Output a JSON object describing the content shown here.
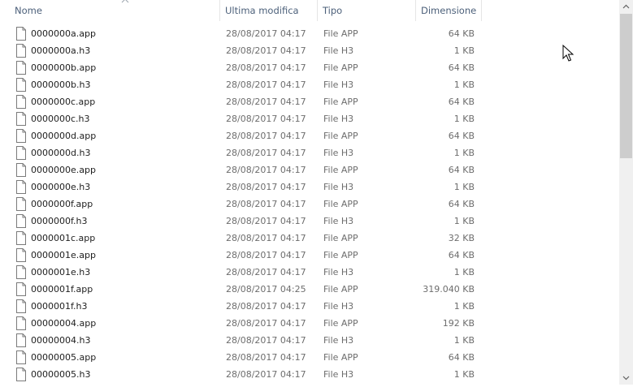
{
  "columns": {
    "name": "Nome",
    "modified": "Ultima modifica",
    "type": "Tipo",
    "size": "Dimensione"
  },
  "files": [
    {
      "name": "0000000a.app",
      "modified": "28/08/2017 04:17",
      "type": "File APP",
      "size": "64 KB"
    },
    {
      "name": "0000000a.h3",
      "modified": "28/08/2017 04:17",
      "type": "File H3",
      "size": "1 KB"
    },
    {
      "name": "0000000b.app",
      "modified": "28/08/2017 04:17",
      "type": "File APP",
      "size": "64 KB"
    },
    {
      "name": "0000000b.h3",
      "modified": "28/08/2017 04:17",
      "type": "File H3",
      "size": "1 KB"
    },
    {
      "name": "0000000c.app",
      "modified": "28/08/2017 04:17",
      "type": "File APP",
      "size": "64 KB"
    },
    {
      "name": "0000000c.h3",
      "modified": "28/08/2017 04:17",
      "type": "File H3",
      "size": "1 KB"
    },
    {
      "name": "0000000d.app",
      "modified": "28/08/2017 04:17",
      "type": "File APP",
      "size": "64 KB"
    },
    {
      "name": "0000000d.h3",
      "modified": "28/08/2017 04:17",
      "type": "File H3",
      "size": "1 KB"
    },
    {
      "name": "0000000e.app",
      "modified": "28/08/2017 04:17",
      "type": "File APP",
      "size": "64 KB"
    },
    {
      "name": "0000000e.h3",
      "modified": "28/08/2017 04:17",
      "type": "File H3",
      "size": "1 KB"
    },
    {
      "name": "0000000f.app",
      "modified": "28/08/2017 04:17",
      "type": "File APP",
      "size": "64 KB"
    },
    {
      "name": "0000000f.h3",
      "modified": "28/08/2017 04:17",
      "type": "File H3",
      "size": "1 KB"
    },
    {
      "name": "0000001c.app",
      "modified": "28/08/2017 04:17",
      "type": "File APP",
      "size": "32 KB"
    },
    {
      "name": "0000001e.app",
      "modified": "28/08/2017 04:17",
      "type": "File APP",
      "size": "64 KB"
    },
    {
      "name": "0000001e.h3",
      "modified": "28/08/2017 04:17",
      "type": "File H3",
      "size": "1 KB"
    },
    {
      "name": "0000001f.app",
      "modified": "28/08/2017 04:25",
      "type": "File APP",
      "size": "319.040 KB"
    },
    {
      "name": "0000001f.h3",
      "modified": "28/08/2017 04:17",
      "type": "File H3",
      "size": "1 KB"
    },
    {
      "name": "00000004.app",
      "modified": "28/08/2017 04:17",
      "type": "File APP",
      "size": "192 KB"
    },
    {
      "name": "00000004.h3",
      "modified": "28/08/2017 04:17",
      "type": "File H3",
      "size": "1 KB"
    },
    {
      "name": "00000005.app",
      "modified": "28/08/2017 04:17",
      "type": "File APP",
      "size": "64 KB"
    },
    {
      "name": "00000005.h3",
      "modified": "28/08/2017 04:17",
      "type": "File H3",
      "size": "1 KB"
    }
  ],
  "icons": {
    "file": "file-icon",
    "sort": "sort-ascending-icon",
    "cursor": "mouse-pointer-icon"
  }
}
